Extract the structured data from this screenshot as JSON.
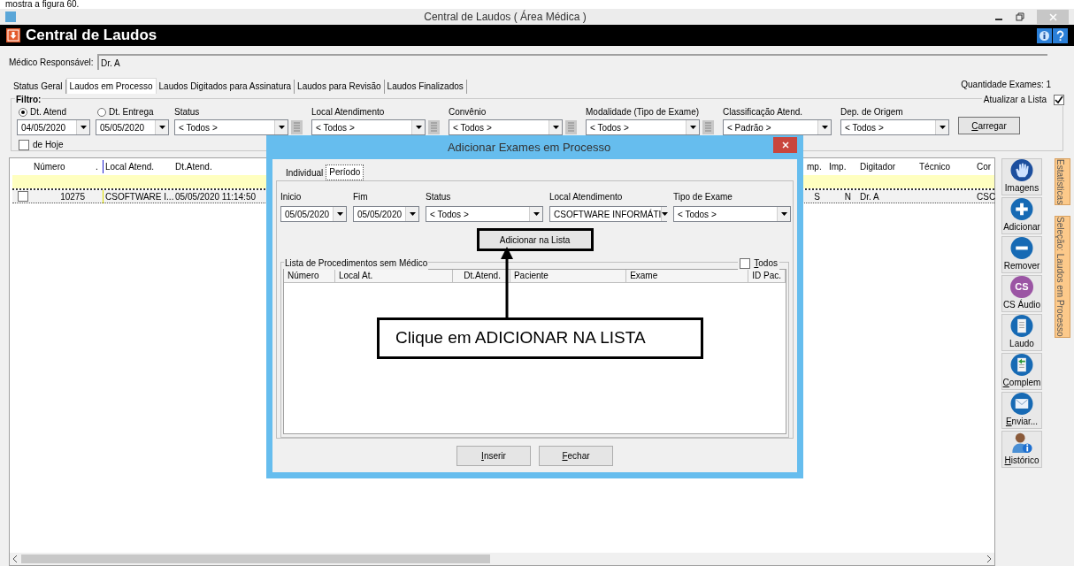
{
  "document_caption": "mostra a figura 60.",
  "window": {
    "title": "Central de Laudos ( Área Médica )"
  },
  "header": {
    "title": "Central de Laudos"
  },
  "responsible": {
    "label": "Médico Responsável:",
    "value": "Dr. A"
  },
  "tabs": [
    {
      "label": "Status Geral",
      "selected": false
    },
    {
      "label": "Laudos em Processo",
      "selected": true
    },
    {
      "label": "Laudos Digitados para Assinatura",
      "selected": false
    },
    {
      "label": "Laudos para Revisão",
      "selected": false
    },
    {
      "label": "Laudos Finalizados",
      "selected": false
    }
  ],
  "exam_count": "Quantidade Exames: 1",
  "filter": {
    "legend": "Filtro:",
    "date_options": [
      {
        "label": "Dt. Atend",
        "selected": true,
        "value": "04/05/2020"
      },
      {
        "label": "Dt. Entrega",
        "selected": false,
        "value": "05/05/2020"
      }
    ],
    "selects": [
      {
        "label": "Status",
        "value": "< Todos >",
        "picker": true
      },
      {
        "label": "Local Atendimento",
        "value": "< Todos >",
        "picker": true
      },
      {
        "label": "Convênio",
        "value": "< Todos >",
        "picker": true
      },
      {
        "label": "Modalidade (Tipo de Exame)",
        "value": "< Todos >",
        "picker": true
      },
      {
        "label": "Classificação Atend.",
        "value": "< Padrão >",
        "picker": false
      },
      {
        "label": "Dep. de Origem",
        "value": "< Todos >",
        "picker": false
      }
    ],
    "today": {
      "label": "de Hoje",
      "checked": false
    },
    "refresh": {
      "label": "Atualizar a Lista",
      "checked": true
    },
    "load_button": {
      "label": "Carregar",
      "mnemonic": true
    }
  },
  "table": {
    "columns": [
      "Número",
      ".",
      "Local Atend.",
      "Dt.Atend.",
      "mp.",
      "Imp.",
      "Digitador",
      "Técnico",
      "Cor"
    ],
    "rows": [
      {
        "checked": false,
        "cells": [
          "10275",
          null,
          "CSOFTWARE I...",
          "05/05/2020 11:14:50",
          "S",
          "N",
          "Dr. A",
          null,
          "CSC"
        ]
      }
    ]
  },
  "toolbar": [
    {
      "kind": "hand",
      "label": "Imagens",
      "mnemonic": false
    },
    {
      "kind": "plus",
      "label": "Adicionar",
      "mnemonic": false
    },
    {
      "kind": "minus",
      "label": "Remover",
      "mnemonic": false
    },
    {
      "kind": "cs",
      "label": "CS Áudio",
      "icon_text": "CS",
      "mnemonic": false
    },
    {
      "kind": "document",
      "label": "Laudo",
      "mnemonic": false
    },
    {
      "kind": "document-arrow",
      "label": "Complem",
      "mnemonic": true
    },
    {
      "kind": "envelope",
      "label": "Enviar...",
      "mnemonic": true
    },
    {
      "kind": "person",
      "label": "Histórico",
      "mnemonic": true
    }
  ],
  "side_tabs": [
    "Estatísticas",
    "Seleção: Laudos em Processo"
  ],
  "dialog": {
    "title": "Adicionar Exames em Processo",
    "tabs": [
      {
        "label": "Individual",
        "selected": false
      },
      {
        "label": "Período",
        "selected": true
      }
    ],
    "fields": [
      {
        "label": "Inicio",
        "value": "05/05/2020"
      },
      {
        "label": "Fim",
        "value": "05/05/2020"
      },
      {
        "label": "Status",
        "value": "< Todos >"
      },
      {
        "label": "Local Atendimento",
        "value": "CSOFTWARE INFORMÁTI"
      },
      {
        "label": "Tipo de Exame",
        "value": "< Todos >"
      }
    ],
    "add_button": "Adicionar na Lista",
    "group": {
      "legend": "Lista de Procedimentos sem Médico",
      "all": {
        "label": "Todos",
        "checked": false,
        "mnemonic": true
      },
      "columns": [
        "Número",
        "Local At.",
        "Dt.Atend.",
        "Paciente",
        "Exame",
        "ID Pac."
      ]
    },
    "buttons": [
      {
        "label": "Inserir",
        "mnemonic": true
      },
      {
        "label": "Fechar",
        "mnemonic": true
      }
    ],
    "callout": "Clique em ADICIONAR NA LISTA"
  }
}
